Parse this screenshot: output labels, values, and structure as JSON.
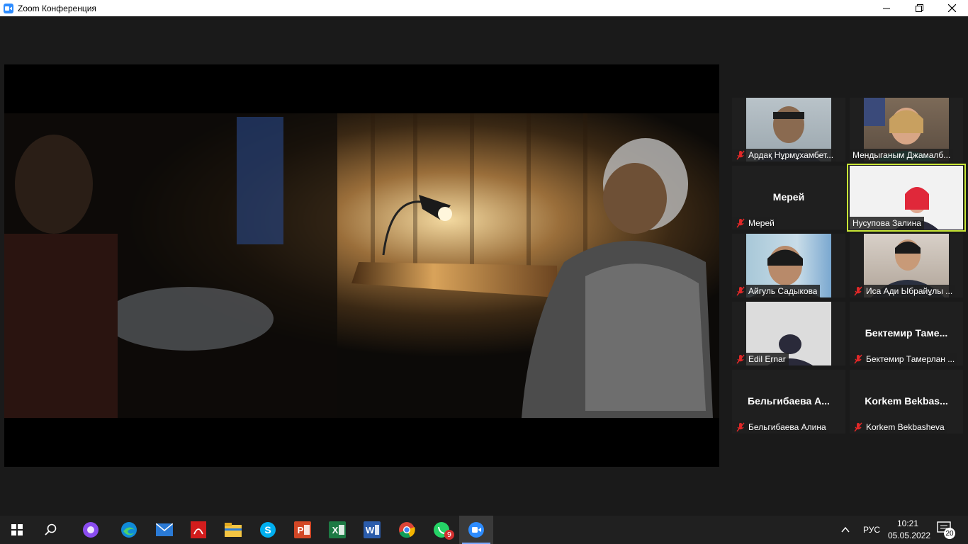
{
  "window": {
    "title": "Zoom Конференция",
    "controls": [
      "minimize-icon",
      "restore-icon",
      "close-icon"
    ]
  },
  "participants": [
    {
      "name": "Ардақ Нұрмұхамбет...",
      "video": true,
      "muted": true
    },
    {
      "name": "Мендыганым Джамалб...",
      "video": true,
      "muted": false
    },
    {
      "name": "Мерей",
      "display": "Мерей",
      "video": false,
      "muted": true
    },
    {
      "name": "Нусупова Залина",
      "video": true,
      "muted": false,
      "active_speaker": true
    },
    {
      "name": "Айгуль Садыкова",
      "video": true,
      "muted": true
    },
    {
      "name": "Иса Ади Ыбрайұлы ...",
      "video": true,
      "muted": true
    },
    {
      "name": "Edil Ernar",
      "video": true,
      "muted": true
    },
    {
      "name": "Бектемир Тамерлан ...",
      "display": "Бектемир Таме...",
      "video": false,
      "muted": true
    },
    {
      "name": "Бельгибаева Алина",
      "display": "Бельгибаева А...",
      "video": false,
      "muted": true
    },
    {
      "name": "Korkem Bekbasheva",
      "display": "Korkem Bekbas...",
      "video": false,
      "muted": true
    }
  ],
  "taskbar": {
    "apps": [
      "windows-start-icon",
      "search-icon",
      "alice-assistant-icon",
      "edge-icon",
      "mail-icon",
      "acrobat-icon",
      "file-explorer-icon",
      "skype-icon",
      "powerpoint-icon",
      "excel-icon",
      "word-icon",
      "chrome-icon",
      "whatsapp-icon",
      "zoom-icon"
    ],
    "whatsapp_badge": "9",
    "language": "РУС",
    "time": "10:21",
    "date": "05.05.2022",
    "notifications": "20"
  },
  "colors": {
    "zoom_blue": "#2d8cff",
    "active_speaker": "#c8e636",
    "muted_red": "#e02828"
  }
}
